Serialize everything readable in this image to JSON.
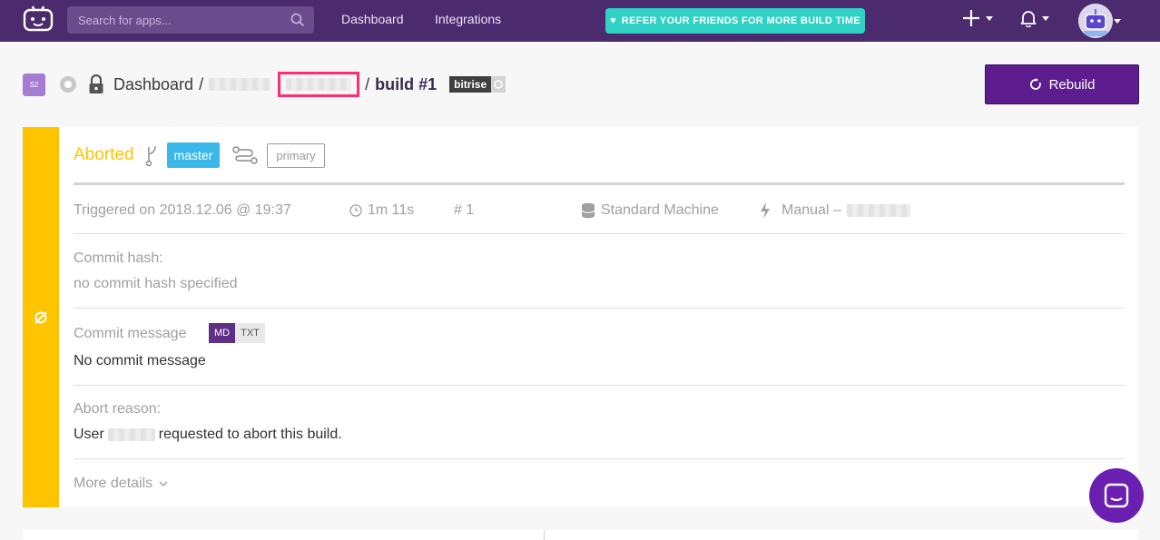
{
  "topbar": {
    "search_placeholder": "Search for apps...",
    "nav": [
      "Dashboard",
      "Integrations"
    ],
    "refer_prefix": "REFER YOUR FRIENDS FOR ",
    "refer_bold": "MORE BUILD TIME"
  },
  "breadcrumb": {
    "app_initials": "S2",
    "dashboard": "Dashboard",
    "separator": "/",
    "build": "build #1",
    "stack": "bitrise"
  },
  "rebuild_label": "Rebuild",
  "build": {
    "status": "Aborted",
    "branch": "master",
    "workflow": "primary",
    "triggered": "Triggered on 2018.12.06 @ 19:37",
    "duration": "1m 11s",
    "number": "# 1",
    "machine": "Standard Machine",
    "trigger_type": "Manual –",
    "commit_hash_label": "Commit hash:",
    "commit_hash_value": "no commit hash specified",
    "commit_message_label": "Commit message",
    "format_md": "MD",
    "format_txt": "TXT",
    "commit_message_value": "No commit message",
    "abort_reason_label": "Abort reason:",
    "abort_reason_prefix": "User",
    "abort_reason_suffix": "requested to abort this build.",
    "more_details": "More details"
  },
  "colors": {
    "topbar": "#4b2a6e",
    "aborted": "#ffc400",
    "branch": "#3bb8ea",
    "rebuild": "#5d1d8f",
    "refer": "#2fd2c4",
    "highlight": "#ff2d6f"
  }
}
